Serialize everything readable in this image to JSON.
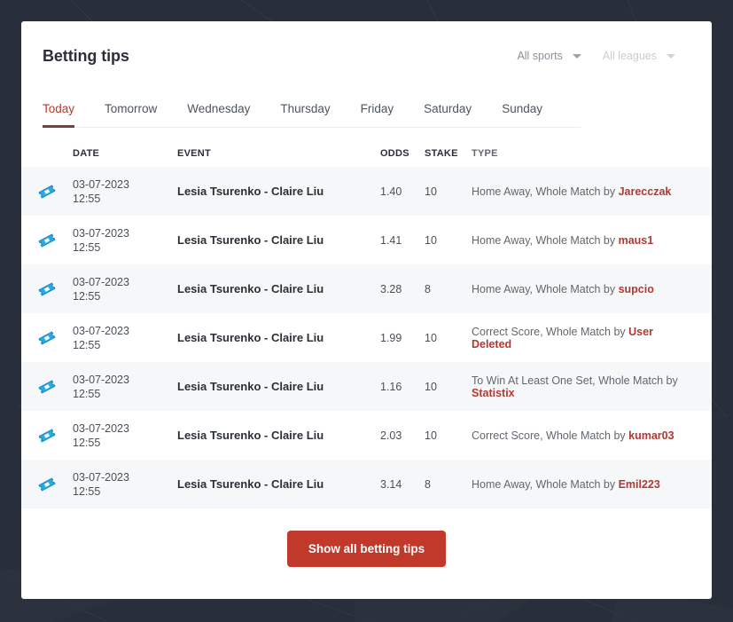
{
  "theme": {
    "page_background": "#282e3a",
    "card_background": "#ffffff",
    "accent_red": "#b03a32",
    "button_red": "#c0392b",
    "ticket_blue": "#29abe2",
    "row_stripe": "#f6f7f9"
  },
  "header": {
    "title": "Betting tips",
    "filters": [
      {
        "label": "All sports",
        "icon": "chevron-down-icon",
        "state": "enabled"
      },
      {
        "label": "All leagues",
        "icon": "chevron-down-icon",
        "state": "muted"
      }
    ]
  },
  "tabs": [
    {
      "label": "Today",
      "active": true
    },
    {
      "label": "Tomorrow",
      "active": false
    },
    {
      "label": "Wednesday",
      "active": false
    },
    {
      "label": "Thursday",
      "active": false
    },
    {
      "label": "Friday",
      "active": false
    },
    {
      "label": "Saturday",
      "active": false
    },
    {
      "label": "Sunday",
      "active": false
    }
  ],
  "table": {
    "columns": {
      "icon": "",
      "date": "DATE",
      "event": "EVENT",
      "odds": "ODDS",
      "stake": "STAKE",
      "type": "TYPE"
    },
    "rows": [
      {
        "icon": "ticket-icon",
        "date": "03-07-2023",
        "time": "12:55",
        "event": "Lesia Tsurenko - Claire Liu",
        "odds": "1.40",
        "stake": "10",
        "type_text": "Home Away, Whole Match by ",
        "type_user": "Jarecczak"
      },
      {
        "icon": "ticket-icon",
        "date": "03-07-2023",
        "time": "12:55",
        "event": "Lesia Tsurenko - Claire Liu",
        "odds": "1.41",
        "stake": "10",
        "type_text": "Home Away, Whole Match by ",
        "type_user": "maus1"
      },
      {
        "icon": "ticket-icon",
        "date": "03-07-2023",
        "time": "12:55",
        "event": "Lesia Tsurenko - Claire Liu",
        "odds": "3.28",
        "stake": "8",
        "type_text": "Home Away, Whole Match by ",
        "type_user": "supcio"
      },
      {
        "icon": "ticket-icon",
        "date": "03-07-2023",
        "time": "12:55",
        "event": "Lesia Tsurenko - Claire Liu",
        "odds": "1.99",
        "stake": "10",
        "type_text": "Correct Score, Whole Match by ",
        "type_user": "User Deleted"
      },
      {
        "icon": "ticket-icon",
        "date": "03-07-2023",
        "time": "12:55",
        "event": "Lesia Tsurenko - Claire Liu",
        "odds": "1.16",
        "stake": "10",
        "type_text": "To Win At Least One Set, Whole Match by ",
        "type_user": "Statistix"
      },
      {
        "icon": "ticket-icon",
        "date": "03-07-2023",
        "time": "12:55",
        "event": "Lesia Tsurenko - Claire Liu",
        "odds": "2.03",
        "stake": "10",
        "type_text": "Correct Score, Whole Match by ",
        "type_user": "kumar03"
      },
      {
        "icon": "ticket-icon",
        "date": "03-07-2023",
        "time": "12:55",
        "event": "Lesia Tsurenko - Claire Liu",
        "odds": "3.14",
        "stake": "8",
        "type_text": "Home Away, Whole Match by ",
        "type_user": "Emil223"
      }
    ]
  },
  "footer": {
    "show_all_label": "Show all betting tips"
  }
}
